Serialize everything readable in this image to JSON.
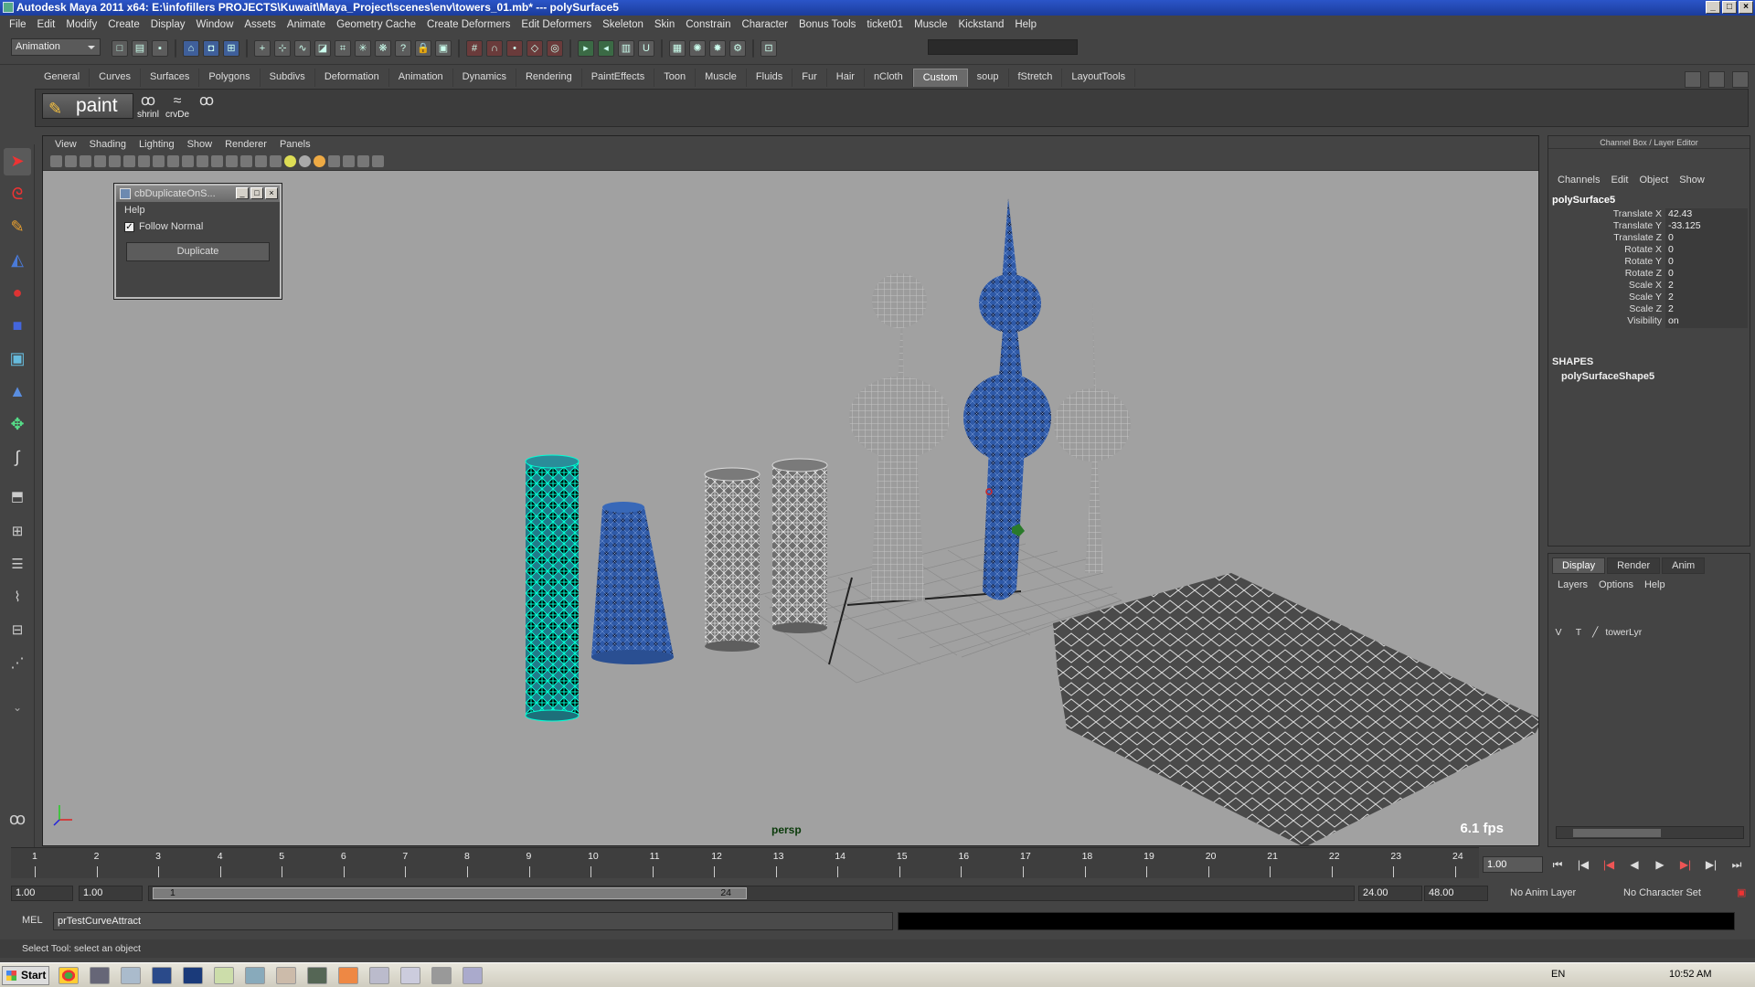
{
  "window": {
    "title": "Autodesk Maya 2011 x64: E:\\infofillers PROJECTS\\Kuwait\\Maya_Project\\scenes\\env\\towers_01.mb*  ---  polySurface5"
  },
  "menubar": [
    "File",
    "Edit",
    "Modify",
    "Create",
    "Display",
    "Window",
    "Assets",
    "Animate",
    "Geometry Cache",
    "Create Deformers",
    "Edit Deformers",
    "Skeleton",
    "Skin",
    "Constrain",
    "Character",
    "Bonus Tools",
    "ticket01",
    "Muscle",
    "Kickstand",
    "Help"
  ],
  "status_line": {
    "mode": "Animation"
  },
  "shelf": {
    "tabs": [
      "General",
      "Curves",
      "Surfaces",
      "Polygons",
      "Subdivs",
      "Deformation",
      "Animation",
      "Dynamics",
      "Rendering",
      "PaintEffects",
      "Toon",
      "Muscle",
      "Fluids",
      "Fur",
      "Hair",
      "nCloth",
      "Custom",
      "soup",
      "fStretch",
      "LayoutTools"
    ],
    "active_tab": "Custom",
    "paint_label": "paint",
    "btn1": "shrinl",
    "btn2": "crvDe"
  },
  "viewport": {
    "menu": [
      "View",
      "Shading",
      "Lighting",
      "Show",
      "Renderer",
      "Panels"
    ],
    "camera": "persp",
    "fps": "6.1 fps"
  },
  "dup_window": {
    "title": "cbDuplicateOnS...",
    "help": "Help",
    "follow_normal": "Follow Normal",
    "follow_normal_checked": true,
    "button": "Duplicate"
  },
  "channel_box": {
    "header": "Channel Box / Layer Editor",
    "tabs": [
      "Channels",
      "Edit",
      "Object",
      "Show"
    ],
    "object": "polySurface5",
    "attributes": [
      {
        "name": "Translate X",
        "value": "42.43"
      },
      {
        "name": "Translate Y",
        "value": "-33.125"
      },
      {
        "name": "Translate Z",
        "value": "0"
      },
      {
        "name": "Rotate X",
        "value": "0"
      },
      {
        "name": "Rotate Y",
        "value": "0"
      },
      {
        "name": "Rotate Z",
        "value": "0"
      },
      {
        "name": "Scale X",
        "value": "2"
      },
      {
        "name": "Scale Y",
        "value": "2"
      },
      {
        "name": "Scale Z",
        "value": "2"
      },
      {
        "name": "Visibility",
        "value": "on"
      }
    ],
    "shapes_label": "SHAPES",
    "shape": "polySurfaceShape5"
  },
  "layer_editor": {
    "tabs": [
      "Display",
      "Render",
      "Anim"
    ],
    "active_tab": "Display",
    "menu": [
      "Layers",
      "Options",
      "Help"
    ],
    "layer": {
      "v": "V",
      "t": "T",
      "name": "towerLyr"
    }
  },
  "timeline": {
    "ticks": [
      "1",
      "2",
      "3",
      "4",
      "5",
      "6",
      "7",
      "8",
      "9",
      "10",
      "11",
      "12",
      "13",
      "14",
      "15",
      "16",
      "17",
      "18",
      "19",
      "20",
      "21",
      "22",
      "23",
      "24"
    ],
    "current_frame": "1.00"
  },
  "range": {
    "start": "1.00",
    "playback_start": "1.00",
    "slider_start": "1",
    "slider_end": "24",
    "playback_end": "24.00",
    "end": "48.00",
    "anim_layer": "No Anim Layer",
    "character_set": "No Character Set"
  },
  "command": {
    "lang": "MEL",
    "input": "prTestCurveAttract"
  },
  "help_line": "Select Tool: select an object",
  "taskbar": {
    "start": "Start",
    "lang": "EN",
    "clock": "10:52 AM"
  },
  "colors": {
    "selection": "#00ffd5",
    "mesh_blue": "#2f5aa8",
    "viewport_bg": "#a1a1a1"
  }
}
